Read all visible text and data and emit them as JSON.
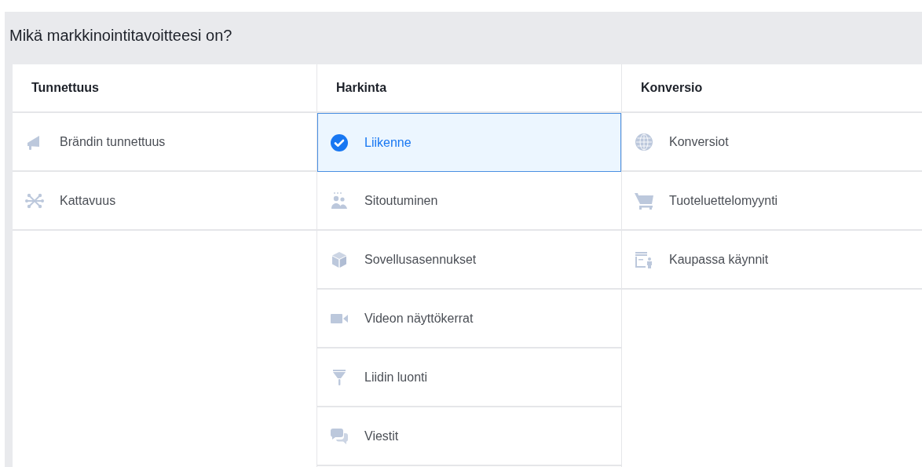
{
  "title": "Mikä markkinointitavoitteesi on?",
  "columns": [
    {
      "heading": "Tunnettuus",
      "items": [
        {
          "label": "Brändin tunnettuus",
          "selected": false
        },
        {
          "label": "Kattavuus",
          "selected": false
        }
      ]
    },
    {
      "heading": "Harkinta",
      "items": [
        {
          "label": "Liikenne",
          "selected": true
        },
        {
          "label": "Sitoutuminen",
          "selected": false
        },
        {
          "label": "Sovellusasennukset",
          "selected": false
        },
        {
          "label": "Videon näyttökerrat",
          "selected": false
        },
        {
          "label": "Liidin luonti",
          "selected": false
        },
        {
          "label": "Viestit",
          "selected": false
        }
      ]
    },
    {
      "heading": "Konversio",
      "items": [
        {
          "label": "Konversiot",
          "selected": false
        },
        {
          "label": "Tuoteluettelomyynti",
          "selected": false
        },
        {
          "label": "Kaupassa käynnit",
          "selected": false
        }
      ]
    }
  ]
}
